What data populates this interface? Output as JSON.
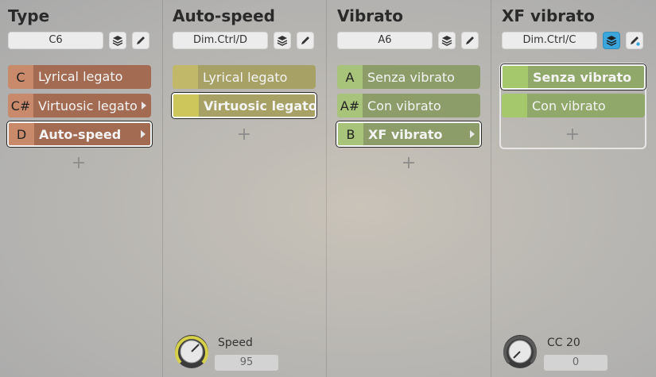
{
  "columns": [
    {
      "title": "Type",
      "header_value": "C6",
      "slots": [
        {
          "key": "C",
          "name": "Lyrical legato"
        },
        {
          "key": "C#",
          "name": "Virtuosic legato"
        },
        {
          "key": "D",
          "name": "Auto-speed"
        }
      ]
    },
    {
      "title": "Auto-speed",
      "header_value": "Dim.Ctrl/D",
      "slots": [
        {
          "key": "",
          "name": "Lyrical legato"
        },
        {
          "key": "",
          "name": "Virtuosic legato"
        }
      ],
      "knob": {
        "label": "Speed",
        "value": "95",
        "level": 0.75
      }
    },
    {
      "title": "Vibrato",
      "header_value": "A6",
      "slots": [
        {
          "key": "A",
          "name": "Senza vibrato"
        },
        {
          "key": "A#",
          "name": "Con vibrato"
        },
        {
          "key": "B",
          "name": "XF vibrato"
        }
      ]
    },
    {
      "title": "XF vibrato",
      "header_value": "Dim.Ctrl/C",
      "slots": [
        {
          "key": "",
          "name": "Senza vibrato"
        },
        {
          "key": "",
          "name": "Con vibrato"
        }
      ],
      "knob": {
        "label": "CC 20",
        "value": "0",
        "level": 0.0
      }
    }
  ],
  "add_symbol": "+",
  "icons": {
    "layers": "layers-icon",
    "edit": "pencil-icon"
  },
  "colors": {
    "type_key": "#c98a6c",
    "type_name": "#a36b52",
    "autospeed_key": "#c1b86a",
    "autospeed_name": "#a7a166",
    "vibrato_key": "#a8c47a",
    "vibrato_name": "#8c9d6a",
    "xf_key": "#a6c86c",
    "xf_name": "#90a86a",
    "accent": "#3aa6dc"
  }
}
